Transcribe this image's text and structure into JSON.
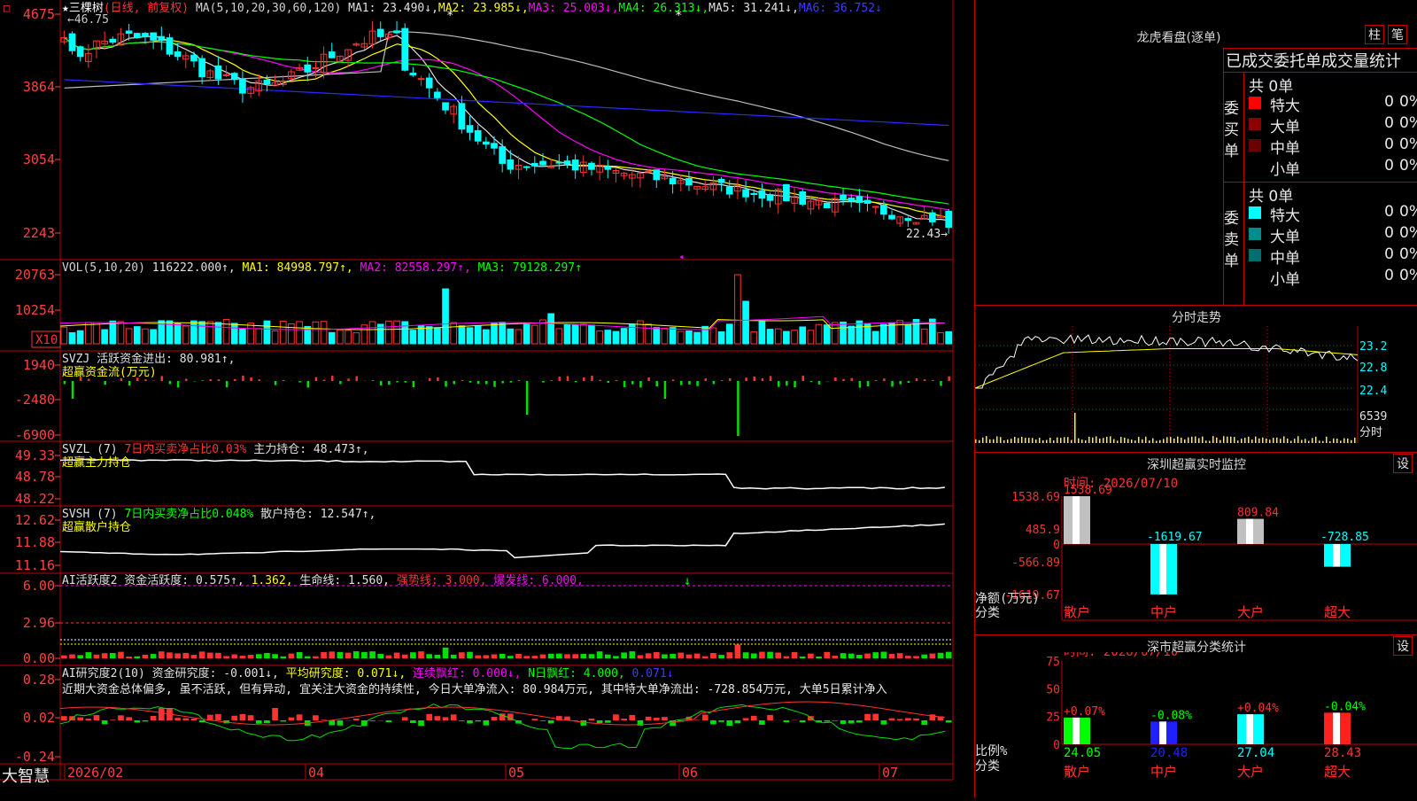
{
  "app": {
    "logo": "大智慧",
    "stock_name": "三棵树",
    "period_label": "(日线, 前复权)",
    "hi_marker": "46.75",
    "low_marker": "22.43"
  },
  "colors": {
    "up": "#ff3232",
    "down": "#00ffff",
    "ma1": "#e0e0e0",
    "ma2": "#ffff00",
    "ma3": "#ff00ff",
    "ma4": "#00ff00",
    "ma5": "#bdbdbd",
    "ma6": "#2a2aff",
    "grid": "#c00000",
    "axis_text": "#ff4040"
  },
  "panes": {
    "price": {
      "legend": [
        {
          "t": "★三棵树",
          "c": "#ffffff"
        },
        {
          "t": "(日线, 前复权)",
          "c": "#ff3030"
        },
        {
          "t": " MA(5,10,20,30,60,120) ",
          "c": "#d0d0d0"
        },
        {
          "t": "MA1: 23.490↓,",
          "c": "#e0e0e0"
        },
        {
          "t": "MA2: 23.985↓,",
          "c": "#ffff00"
        },
        {
          "t": "MA3: 25.003↓,",
          "c": "#ff00ff"
        },
        {
          "t": "MA4: 26.313↓,",
          "c": "#00ff00"
        },
        {
          "t": "MA5: 31.241↓,",
          "c": "#e0e0e0"
        },
        {
          "t": "MA6: 36.752↓",
          "c": "#3c3cff"
        }
      ],
      "ticks": [
        "4675",
        "3864",
        "3054",
        "2243"
      ]
    },
    "vol": {
      "legend": [
        {
          "t": "VOL(5,10,20) ",
          "c": "#d0d0d0"
        },
        {
          "t": "116222.000↑,",
          "c": "#e0e0e0"
        },
        {
          "t": " MA1: 84998.797↑,",
          "c": "#ffff00"
        },
        {
          "t": " MA2: 82558.297↑,",
          "c": "#ff00ff"
        },
        {
          "t": " MA3: 79128.297↑",
          "c": "#00ff00"
        }
      ],
      "ticks": [
        "20763",
        "10254"
      ],
      "unit": "X10"
    },
    "svzj": {
      "legend": [
        {
          "t": "SVZJ  活跃资金进出: 80.981↑,",
          "c": "#e0e0e0"
        }
      ],
      "sub": "超赢资金流(万元)",
      "ticks": [
        "1940",
        "-2480",
        "-6900"
      ]
    },
    "svzl": {
      "legend": [
        {
          "t": "SVZL (7) ",
          "c": "#e0e0e0"
        },
        {
          "t": "7日内买卖净占比0.03%",
          "c": "#ff3030"
        },
        {
          "t": " 主力持仓: 48.473↑,",
          "c": "#e0e0e0"
        }
      ],
      "sub": "超赢主力持仓",
      "ticks": [
        "49.33",
        "48.78",
        "48.22"
      ]
    },
    "svsh": {
      "legend": [
        {
          "t": "SVSH (7) ",
          "c": "#e0e0e0"
        },
        {
          "t": "7日内买卖净占比0.048%",
          "c": "#00ff00"
        },
        {
          "t": " 散户持仓: 12.547↑,",
          "c": "#e0e0e0"
        }
      ],
      "sub": "超赢散户持仓",
      "ticks": [
        "12.62",
        "11.88",
        "11.16"
      ]
    },
    "ai1": {
      "legend": [
        {
          "t": "AI活跃度2 资金活跃度: 0.575↑,",
          "c": "#e0e0e0"
        },
        {
          "t": " 1.362,",
          "c": "#ffff00"
        },
        {
          "t": " 生命线: 1.560,",
          "c": "#e0e0e0"
        },
        {
          "t": " 强势线: 3.000,",
          "c": "#ff3030"
        },
        {
          "t": " 爆发线: 6.000,",
          "c": "#ff00ff"
        }
      ],
      "ticks": [
        "6.00",
        "2.96",
        "0.00"
      ]
    },
    "ai2": {
      "legend": [
        {
          "t": "AI研究度2(10) 资金研究度: -0.001↓,",
          "c": "#e0e0e0"
        },
        {
          "t": " 平均研究度: 0.071↓,",
          "c": "#ffff00"
        },
        {
          "t": " 连续飘红: 0.000↓,",
          "c": "#ff00ff"
        },
        {
          "t": " N日飘红: 4.000,",
          "c": "#00ff00"
        },
        {
          "t": " 0.071↓",
          "c": "#3c3cff"
        }
      ],
      "comment": "近期大资金总体偏多, 虽不活跃, 但有异动, 宜关注大资金的持续性, 今日大单净流入: 80.984万元, 其中特大单净流出: -728.854万元, 大单5日累计净入",
      "ticks": [
        "0.28",
        "0.02",
        "-0.24"
      ]
    }
  },
  "x_axis": [
    "2026/02",
    "04",
    "05",
    "06",
    "07"
  ],
  "chart_data": {
    "type": "candlestick",
    "title": "三棵树 (日线, 前复权)",
    "y_ticks_price": [
      4675,
      3864,
      3054,
      2243
    ],
    "last_close": 22.43,
    "period_high": 46.75,
    "ma_values": {
      "MA1": 23.49,
      "MA2": 23.985,
      "MA3": 25.003,
      "MA4": 26.313,
      "MA5": 31.241,
      "MA6": 36.752
    },
    "volume": {
      "value": 116222.0,
      "MA1": 84998.797,
      "MA2": 82558.297,
      "MA3": 79128.297
    },
    "svzj_active_fund": 80.981,
    "svzl_main_position": 48.473,
    "svsh_retail_position": 12.547,
    "ai_activity": {
      "active": 0.575,
      "v2": 1.362,
      "life": 1.56,
      "strong": 3.0,
      "burst": 6.0
    },
    "ai_research": {
      "research": -0.001,
      "avg": 0.071,
      "cont_red": 0.0,
      "n_red": 4.0,
      "v5": 0.071
    }
  },
  "right": {
    "dragon_title": "龙虎看盘(逐单)",
    "btn1": "柱",
    "btn2": "笔",
    "stat_header": "已成交委托单成交量统计",
    "buy_side": "委买单",
    "sell_side": "委卖单",
    "buy_total": "共 0单",
    "sell_total": "共 0单",
    "buy_rows": [
      {
        "label": "特大",
        "count": "0",
        "pct": "0%",
        "color": "#ff0000"
      },
      {
        "label": "大单",
        "count": "0",
        "pct": "0%",
        "color": "#8c0000"
      },
      {
        "label": "中单",
        "count": "0",
        "pct": "0%",
        "color": "#6a0000"
      },
      {
        "label": "小单",
        "count": "0",
        "pct": "0%",
        "color": "#000000"
      }
    ],
    "sell_rows": [
      {
        "label": "特大",
        "count": "0",
        "pct": "0%",
        "color": "#00ffff"
      },
      {
        "label": "大单",
        "count": "0",
        "pct": "0%",
        "color": "#008c8c"
      },
      {
        "label": "中单",
        "count": "0",
        "pct": "0%",
        "color": "#006e6e"
      },
      {
        "label": "小单",
        "count": "0",
        "pct": "0%",
        "color": "#000000"
      }
    ],
    "intraday_title": "分时走势",
    "intraday_ticks": [
      "23.2",
      "22.8",
      "22.4"
    ],
    "intraday_vol": "6539",
    "intraday_vol_unit": "分时",
    "monitor_title": "深圳超赢实时监控",
    "settings": "设",
    "monitor_time": "时间: 2026/07/10",
    "monitor_ticks": [
      "1538.69",
      "485.9",
      "0",
      "-566.89",
      "-1619.67"
    ],
    "monitor_unit": "净额(万元)",
    "category_label": "分类",
    "monitor_bars": [
      {
        "cat": "散户",
        "value": 1538.69,
        "label": "1538.69"
      },
      {
        "cat": "中户",
        "value": -1619.67,
        "label": "-1619.67"
      },
      {
        "cat": "大户",
        "value": 809.84,
        "label": "809.84"
      },
      {
        "cat": "超大",
        "value": -728.85,
        "label": "-728.85"
      }
    ],
    "class_title": "深市超赢分类统计",
    "class_time": "时间: 2026/07/10",
    "class_ticks": [
      "75",
      "50",
      "25",
      "0"
    ],
    "class_unit": "比例%",
    "class_bars": [
      {
        "cat": "散户",
        "value": 24.05,
        "label": "24.05",
        "delta": "+0.07%",
        "color": "#00ff00"
      },
      {
        "cat": "中户",
        "value": 20.48,
        "label": "20.48",
        "delta": "-0.08%",
        "color": "#2020ff"
      },
      {
        "cat": "大户",
        "value": 27.04,
        "label": "27.04",
        "delta": "+0.04%",
        "color": "#00ffff"
      },
      {
        "cat": "超大",
        "value": 28.43,
        "label": "28.43",
        "delta": "-0.04%",
        "color": "#ff2020"
      }
    ]
  }
}
